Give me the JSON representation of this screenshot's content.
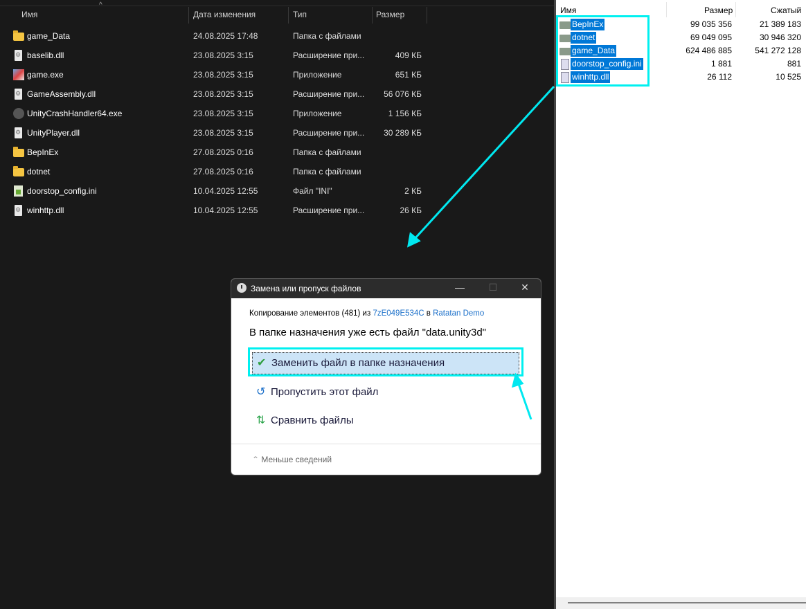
{
  "left_pane": {
    "columns": [
      "Имя",
      "Дата изменения",
      "Тип",
      "Размер"
    ],
    "rows": [
      {
        "name": "game_Data",
        "date": "24.08.2025 17:48",
        "type": "Папка с файлами",
        "size": "",
        "icon": "folder-icon"
      },
      {
        "name": "baselib.dll",
        "date": "23.08.2025 3:15",
        "type": "Расширение при...",
        "size": "409 КБ",
        "icon": "dll-icon"
      },
      {
        "name": "game.exe",
        "date": "23.08.2025 3:15",
        "type": "Приложение",
        "size": "651 КБ",
        "icon": "exe-icon"
      },
      {
        "name": "GameAssembly.dll",
        "date": "23.08.2025 3:15",
        "type": "Расширение при...",
        "size": "56 076 КБ",
        "icon": "dll-icon"
      },
      {
        "name": "UnityCrashHandler64.exe",
        "date": "23.08.2025 3:15",
        "type": "Приложение",
        "size": "1 156 КБ",
        "icon": "crash-icon"
      },
      {
        "name": "UnityPlayer.dll",
        "date": "23.08.2025 3:15",
        "type": "Расширение при...",
        "size": "30 289 КБ",
        "icon": "dll-icon"
      },
      {
        "name": "BepInEx",
        "date": "27.08.2025 0:16",
        "type": "Папка с файлами",
        "size": "",
        "icon": "folder-icon"
      },
      {
        "name": "dotnet",
        "date": "27.08.2025 0:16",
        "type": "Папка с файлами",
        "size": "",
        "icon": "folder-icon"
      },
      {
        "name": "doorstop_config.ini",
        "date": "10.04.2025 12:55",
        "type": "Файл \"INI\"",
        "size": "2 КБ",
        "icon": "ini-icon"
      },
      {
        "name": "winhttp.dll",
        "date": "10.04.2025 12:55",
        "type": "Расширение при...",
        "size": "26 КБ",
        "icon": "dll-icon"
      }
    ]
  },
  "right_pane": {
    "columns": [
      "Имя",
      "Размер",
      "Сжатый"
    ],
    "rows": [
      {
        "name": "BepInEx",
        "size": "99 035 356",
        "packed": "21 389 183",
        "icon": "folder-icon"
      },
      {
        "name": "dotnet",
        "size": "69 049 095",
        "packed": "30 946 320",
        "icon": "folder-icon"
      },
      {
        "name": "game_Data",
        "size": "624 486 885",
        "packed": "541 272 128",
        "icon": "folder-icon"
      },
      {
        "name": "doorstop_config.ini",
        "size": "1 881",
        "packed": "881",
        "icon": "ini-icon"
      },
      {
        "name": "winhttp.dll",
        "size": "26 112",
        "packed": "10 525",
        "icon": "dll-icon"
      }
    ]
  },
  "dialog": {
    "title": "Замена или пропуск файлов",
    "copy_prefix": "Копирование элементов (481) из ",
    "source": "7zE049E534C",
    "copy_mid": " в ",
    "destination": "Ratatan Demo",
    "message": "В папке назначения уже есть файл \"data.unity3d\"",
    "options": [
      "Заменить файл в папке назначения",
      "Пропустить этот файл",
      "Сравнить файлы"
    ],
    "less_details": "Меньше сведений"
  },
  "colors": {
    "highlight": "#00f0f0",
    "selection": "#0078d7",
    "link": "#1a6fc9"
  }
}
